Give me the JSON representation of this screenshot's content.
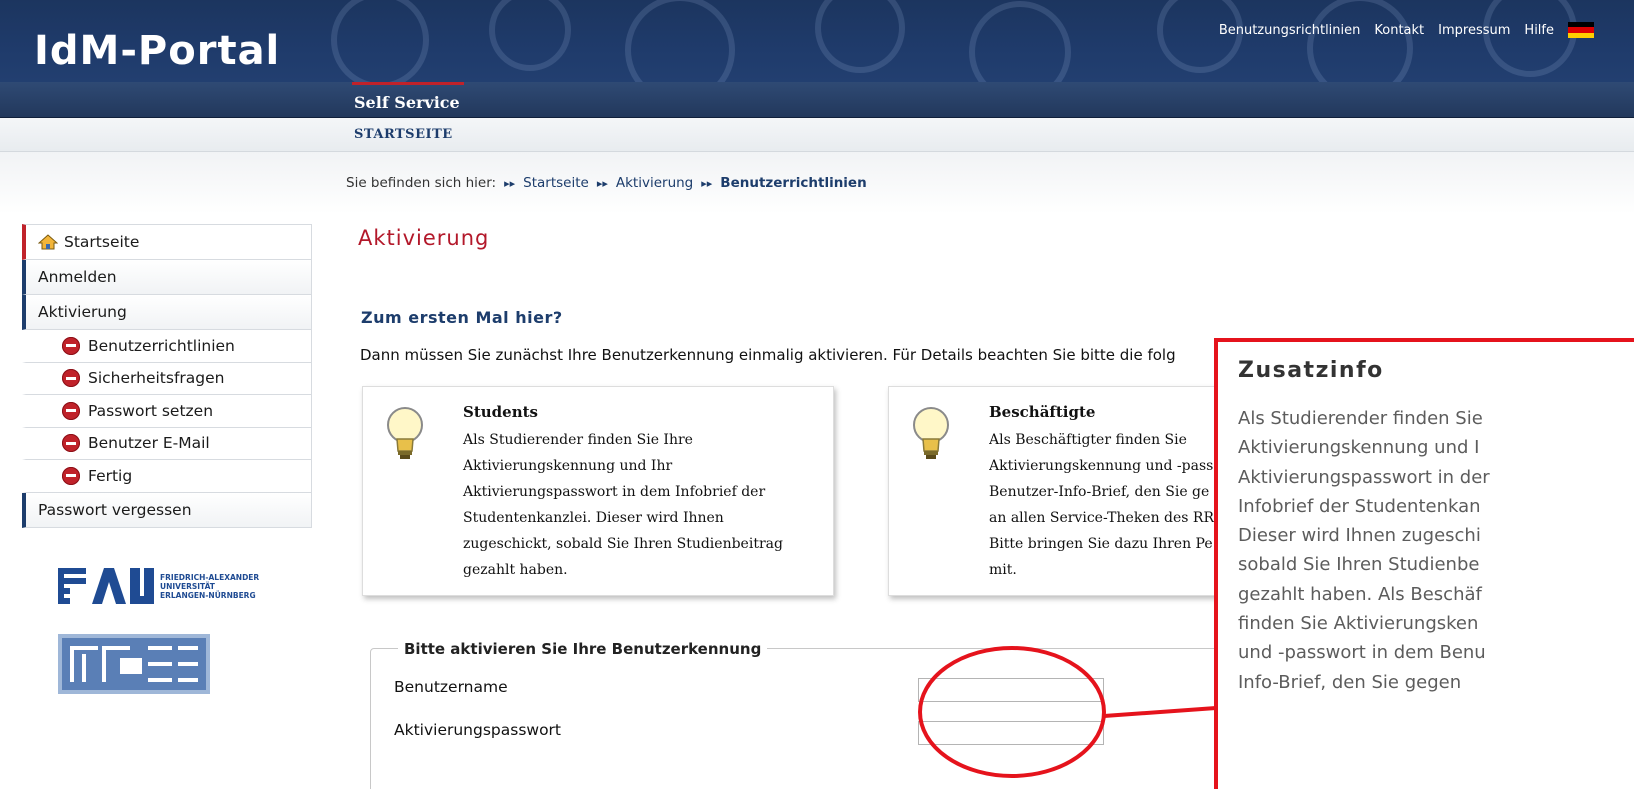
{
  "header": {
    "logo": "IdM-Portal",
    "links": [
      "Benutzungsrichtlinien",
      "Kontakt",
      "Impressum",
      "Hilfe"
    ],
    "language_flag": "german-flag-icon"
  },
  "nav": {
    "active_tab": "Self Service"
  },
  "subnav": {
    "label": "STARTSEITE"
  },
  "breadcrumb": {
    "prefix": "Sie befinden sich hier:",
    "items": [
      "Startseite",
      "Aktivierung",
      "Benutzerrichtlinien"
    ]
  },
  "sidebar": {
    "home": "Startseite",
    "login": "Anmelden",
    "activation": "Aktivierung",
    "steps": [
      "Benutzerrichtlinien",
      "Sicherheitsfragen",
      "Passwort setzen",
      "Benutzer E-Mail",
      "Fertig"
    ],
    "forgot": "Passwort vergessen",
    "logos": [
      "FAU FRIEDRICH-ALEXANDER UNIVERSITÄT ERLANGEN-NÜRNBERG",
      "RRZE"
    ]
  },
  "main": {
    "title": "Aktivierung",
    "heading": "Zum ersten Mal hier?",
    "intro": "Dann müssen Sie zunächst Ihre Benutzerkennung einmalig aktivieren. Für Details beachten Sie bitte die folg",
    "cards": [
      {
        "title": "Students",
        "lines": [
          "Als Studierender finden Sie Ihre",
          "Aktivierungskennung und Ihr",
          "Aktivierungspasswort in dem Infobrief der",
          "Studentenkanzlei. Dieser wird Ihnen",
          "zugeschickt, sobald Sie Ihren Studienbeitrag",
          "gezahlt haben."
        ]
      },
      {
        "title": "Beschäftigte",
        "lines": [
          "Als Beschäftigter finden Sie",
          "Aktivierungskennung und -pass",
          "Benutzer-Info-Brief, den Sie ge",
          "an allen Service-Theken des RR",
          "Bitte bringen Sie dazu Ihren Pe",
          "mit."
        ]
      }
    ],
    "form": {
      "legend": "Bitte aktivieren Sie Ihre Benutzerkennung",
      "fields": [
        {
          "label": "Benutzername",
          "value": ""
        },
        {
          "label": "Aktivierungspasswort",
          "value": ""
        }
      ]
    }
  },
  "callout": {
    "title": "Zusatzinfo",
    "lines": [
      "Als Studierender finden Sie",
      "Aktivierungskennung und I",
      "Aktivierungspasswort in der",
      "Infobrief der Studentenkan",
      "Dieser wird Ihnen zugeschi",
      "sobald Sie Ihren Studienbe",
      "gezahlt haben. Als Beschäf",
      "finden Sie Aktivierungsken",
      "und -passwort in dem Benu",
      "Info-Brief, den Sie gegen"
    ]
  },
  "colors": {
    "header_navy": "#1f3b6b",
    "accent_red": "#c0222a",
    "annotation_red": "#e5131c",
    "link_blue": "#1d3d6c"
  }
}
